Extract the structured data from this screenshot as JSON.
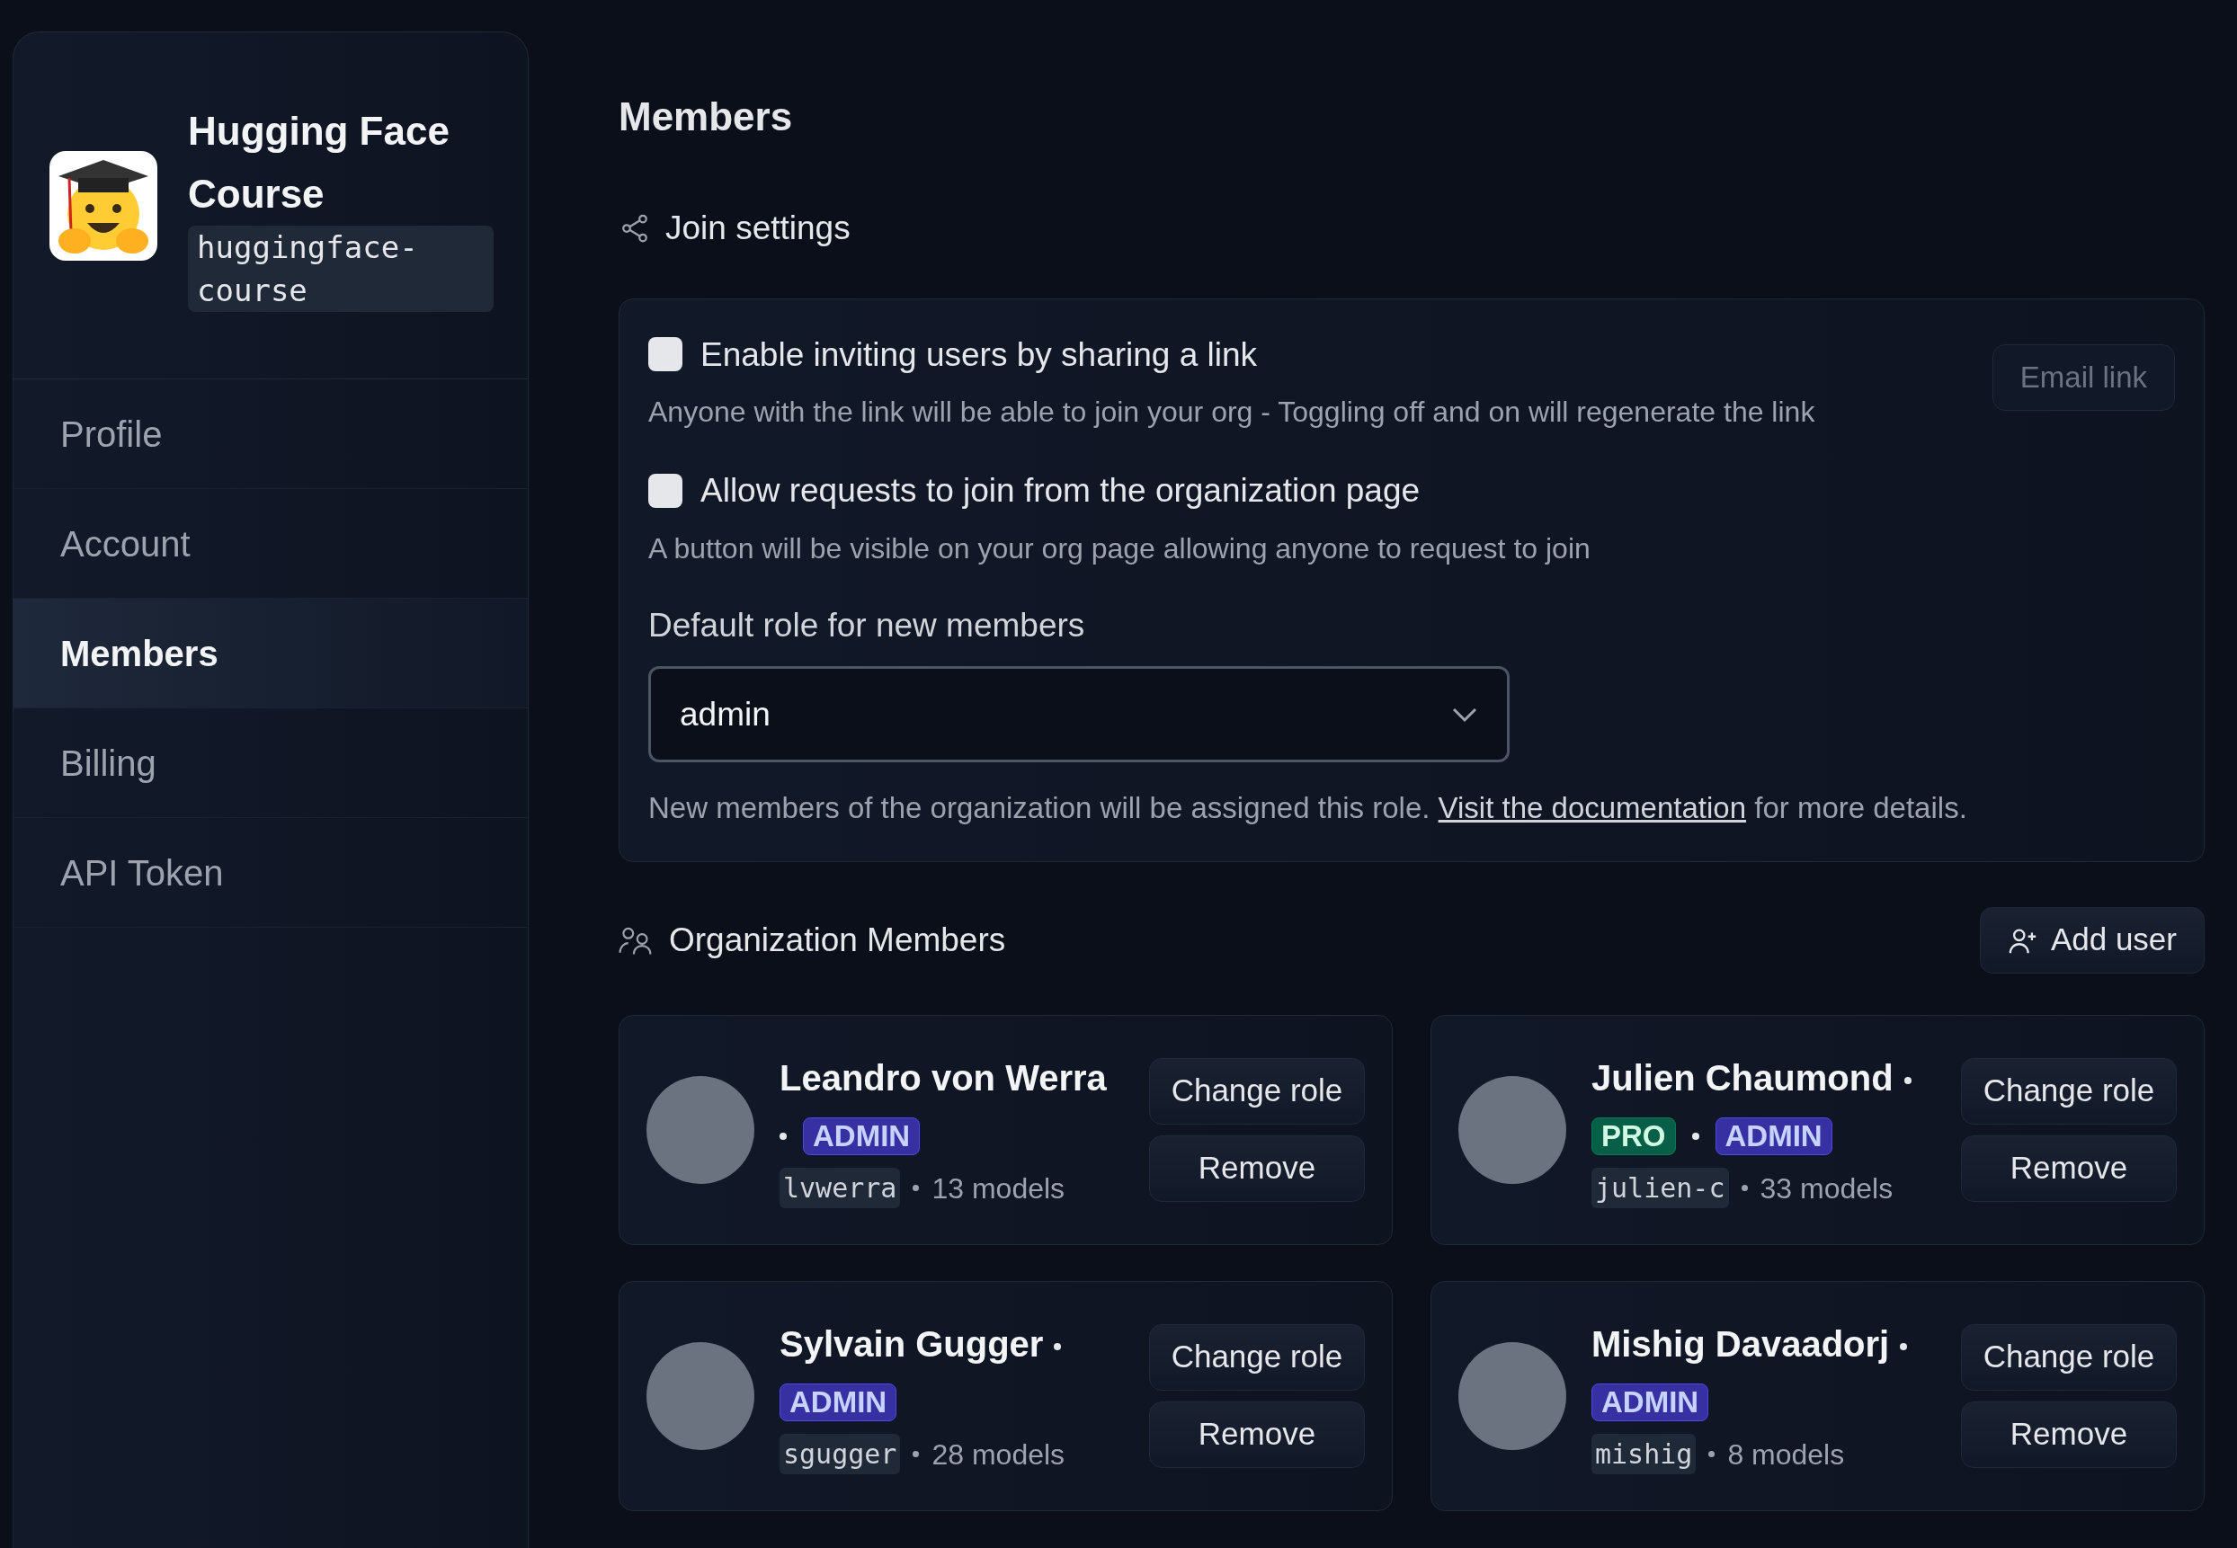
{
  "sidebar": {
    "org_name": "Hugging Face Course",
    "org_handle": "huggingface-course",
    "items": [
      {
        "label": "Profile",
        "selected": false
      },
      {
        "label": "Account",
        "selected": false
      },
      {
        "label": "Members",
        "selected": true
      },
      {
        "label": "Billing",
        "selected": false
      },
      {
        "label": "API Token",
        "selected": false
      }
    ]
  },
  "page_title": "Members",
  "join_settings": {
    "heading": "Join settings",
    "options": [
      {
        "label": "Enable inviting users by sharing a link",
        "description": "Anyone with the link will be able to join your org - Toggling off and on will regenerate the link",
        "checked": false
      },
      {
        "label": "Allow requests to join from the organization page",
        "description": "A button will be visible on your org page allowing anyone to request to join",
        "checked": false
      }
    ],
    "email_link_button": {
      "label": "Email link",
      "disabled": true
    },
    "default_role": {
      "label": "Default role for new members",
      "value": "admin"
    },
    "help": {
      "before": "New members of the organization will be assigned this role.",
      "link": "Visit the documentation",
      "after": "for more details."
    }
  },
  "members_section": {
    "heading": "Organization Members",
    "add_user_button": "Add user",
    "members": [
      {
        "name": "Leandro von Werra",
        "badges": [
          {
            "kind": "admin",
            "label": "ADMIN"
          }
        ],
        "username": "lvwerra",
        "models": "13 models",
        "change_role": "Change role",
        "remove": "Remove"
      },
      {
        "name": "Julien Chaumond",
        "badges": [
          {
            "kind": "pro",
            "label": "PRO"
          },
          {
            "kind": "admin",
            "label": "ADMIN"
          }
        ],
        "username": "julien-c",
        "models": "33 models",
        "change_role": "Change role",
        "remove": "Remove"
      },
      {
        "name": "Sylvain Gugger",
        "badges": [
          {
            "kind": "admin",
            "label": "ADMIN"
          }
        ],
        "username": "sgugger",
        "models": "28 models",
        "change_role": "Change role",
        "remove": "Remove"
      },
      {
        "name": "Mishig Davaadorj",
        "badges": [
          {
            "kind": "admin",
            "label": "ADMIN"
          }
        ],
        "username": "mishig",
        "models": "8 models",
        "change_role": "Change role",
        "remove": "Remove"
      }
    ]
  }
}
